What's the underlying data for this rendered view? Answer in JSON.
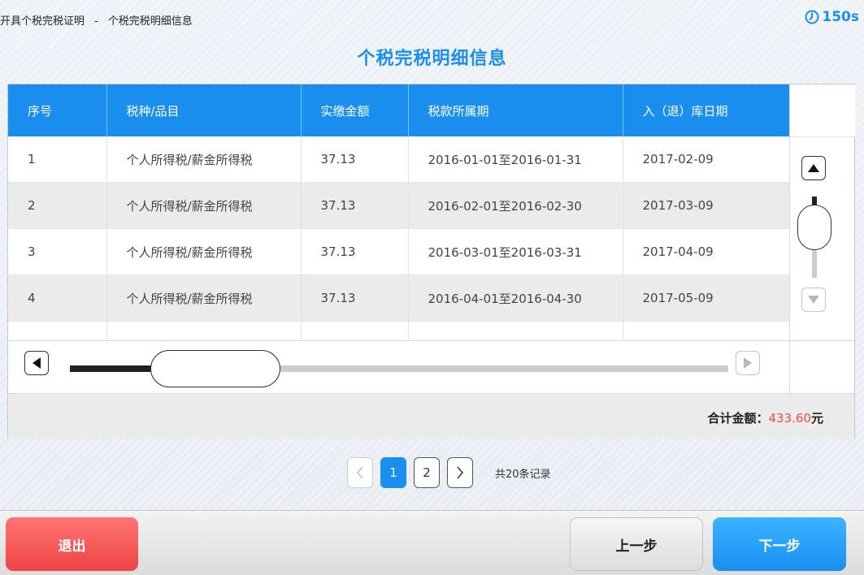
{
  "header": {
    "breadcrumb_parent": "开具个税完税证明",
    "breadcrumb_separator": "-",
    "breadcrumb_current": "个税完税明细信息",
    "timer_label": "150s"
  },
  "page_title": "个税完税明细信息",
  "table": {
    "columns": [
      "序号",
      "税种/品目",
      "实缴金额",
      "税款所属期",
      "入（退）库日期"
    ],
    "rows": [
      [
        "1",
        "个人所得税/薪金所得税",
        "37.13",
        "2016-01-01至2016-01-31",
        "2017-02-09"
      ],
      [
        "2",
        "个人所得税/薪金所得税",
        "37.13",
        "2016-02-01至2016-02-30",
        "2017-03-09"
      ],
      [
        "3",
        "个人所得税/薪金所得税",
        "37.13",
        "2016-03-01至2016-03-31",
        "2017-04-09"
      ],
      [
        "4",
        "个人所得税/薪金所得税",
        "37.13",
        "2016-04-01至2016-04-30",
        "2017-05-09"
      ]
    ]
  },
  "total": {
    "label": "合计金额：",
    "value": "433.60",
    "unit": "元"
  },
  "pagination": {
    "pages": [
      "1",
      "2"
    ],
    "current_page": "1",
    "record_count": "共20条记录"
  },
  "footer": {
    "exit_label": "退出",
    "prev_label": "上一步",
    "next_label": "下一步"
  },
  "colors": {
    "accent": "#1a8ff0",
    "danger": "#ef4444",
    "total_value": "#f04a4a"
  },
  "icons": {
    "timer": "clock-icon",
    "scroll_up": "triangle-up-icon",
    "scroll_down": "triangle-down-icon",
    "scroll_left": "triangle-left-icon",
    "scroll_right": "triangle-right-icon",
    "page_prev": "chevron-left-icon",
    "page_next": "chevron-right-icon"
  }
}
